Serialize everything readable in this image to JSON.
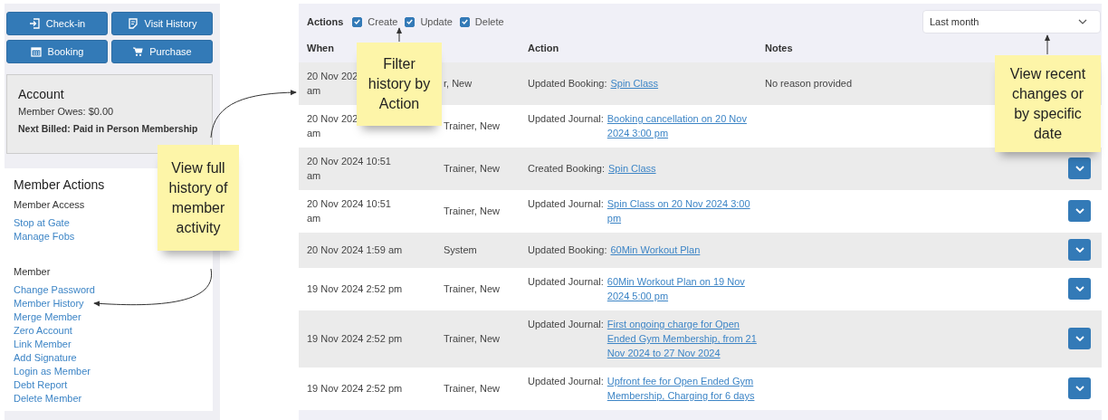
{
  "sidebar": {
    "buttons": [
      {
        "label": "Check-in"
      },
      {
        "label": "Visit History"
      },
      {
        "label": "Booking"
      },
      {
        "label": "Purchase"
      }
    ],
    "account": {
      "title": "Account",
      "owes": "Member Owes: $0.00",
      "next_billed": "Next Billed: Paid in Person Membership"
    },
    "member_actions": {
      "title": "Member Actions",
      "groups": [
        {
          "title": "Member Access",
          "links": [
            "Stop at Gate",
            "Manage Fobs"
          ]
        },
        {
          "title": "Member",
          "links": [
            "Change Password",
            "Member History",
            "Merge Member",
            "Zero Account",
            "Link Member",
            "Add Signature",
            "Login as Member",
            "Debt Report",
            "Delete Member"
          ]
        }
      ]
    }
  },
  "history": {
    "filter": {
      "label": "Actions",
      "options": [
        {
          "label": "Create",
          "checked": true
        },
        {
          "label": "Update",
          "checked": true
        },
        {
          "label": "Delete",
          "checked": true
        }
      ]
    },
    "period": {
      "value": "Last month"
    },
    "columns": {
      "when": "When",
      "action": "Action",
      "notes": "Notes"
    },
    "rows": [
      {
        "when": [
          "20 Nov 202",
          "am"
        ],
        "who": "r, New",
        "action": "Updated Booking:",
        "link": "Spin Class",
        "notes": "No reason provided",
        "expand": false
      },
      {
        "when": [
          "20 Nov 202",
          "am"
        ],
        "who": "Trainer, New",
        "action": "Updated Journal:",
        "link": "Booking cancellation on 20 Nov 2024 3:00 pm",
        "expand": false
      },
      {
        "when": [
          "20 Nov 2024 10:51",
          "am"
        ],
        "who": "Trainer, New",
        "action": "Created Booking:",
        "link": "Spin Class",
        "expand": true
      },
      {
        "when": [
          "20 Nov 2024 10:51",
          "am"
        ],
        "who": "Trainer, New",
        "action": "Updated Journal:",
        "link": "Spin Class on 20 Nov 2024 3:00 pm",
        "expand": true
      },
      {
        "when": [
          "20 Nov 2024 1:59 am"
        ],
        "who": "System",
        "action": "Updated Booking:",
        "link": "60Min Workout Plan",
        "expand": true
      },
      {
        "when": [
          "19 Nov 2024 2:52 pm"
        ],
        "who": "Trainer, New",
        "action": "Updated Journal:",
        "link": "60Min Workout Plan on 19 Nov 2024 5:00 pm",
        "expand": true
      },
      {
        "when": [
          "19 Nov 2024 2:52 pm"
        ],
        "who": "Trainer, New",
        "action": "Updated Journal:",
        "link": "First ongoing charge for Open Ended Gym Membership, from 21 Nov 2024 to 27 Nov 2024",
        "expand": true
      },
      {
        "when": [
          "19 Nov 2024 2:52 pm"
        ],
        "who": "Trainer, New",
        "action": "Updated Journal:",
        "link": "Upfront fee for Open Ended Gym Membership, Charging for 6 days",
        "expand": true
      }
    ]
  },
  "annotations": [
    {
      "text": "Filter history by Action"
    },
    {
      "text": "View full history of member activity"
    },
    {
      "text": "View recent changes or by specific date"
    }
  ]
}
